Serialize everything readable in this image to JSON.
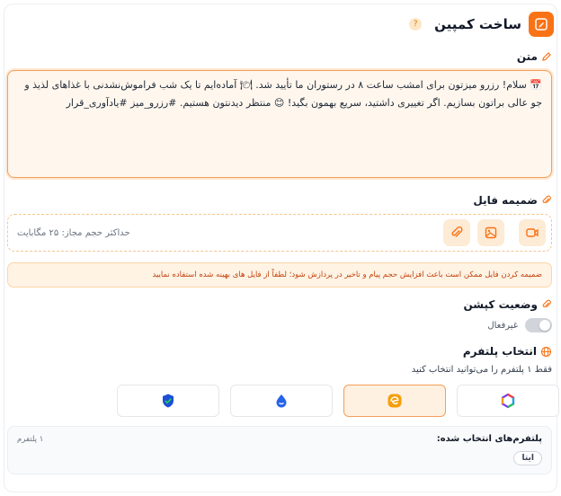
{
  "header": {
    "title": "ساخت کمپین",
    "help": "?"
  },
  "text_section": {
    "label": "متن",
    "content": "📅 سلام! رزرو میزتون برای امشب ساعت ۸ در رستوران ما تأیید شد. 🍽 آماده‌ایم تا یک شب فراموش‌نشدنی با غذاهای لذیذ و جو عالی براتون بسازیم. اگر تغییری داشتید، سریع بهمون بگید! 😊 منتظر دیدنتون هستیم. #رزرو_میز #یادآوری_قرار"
  },
  "attachment": {
    "label": "ضمیمه فایل",
    "max_size": "حداکثر حجم مجاز: ۲۵ مگابایت",
    "warning": "ضمیمه کردن فایل ممکن است باعث افزایش حجم پیام و تاخیر در پردازش شود؛ لطفاً از فایل های بهینه شده استفاده نمایید"
  },
  "caption_status": {
    "label": "وضعیت کپشن",
    "state": "غیرفعال",
    "enabled": false
  },
  "platform": {
    "label": "انتخاب پلتفرم",
    "hint": "فقط ۱ پلتفرم را می‌توانید انتخاب کنید",
    "options": [
      "verified-shield-icon",
      "drop-bubble-icon",
      "eitaa-icon",
      "rubika-icon"
    ],
    "active_index": 2,
    "selected_title": "پلتفرم‌های انتخاب شده:",
    "selected_count": "۱ پلتفرم",
    "selected_chip": "ایتا"
  },
  "colors": {
    "accent": "#f97316",
    "accent_light": "#fff1e2",
    "warn_text": "#c2410c"
  }
}
